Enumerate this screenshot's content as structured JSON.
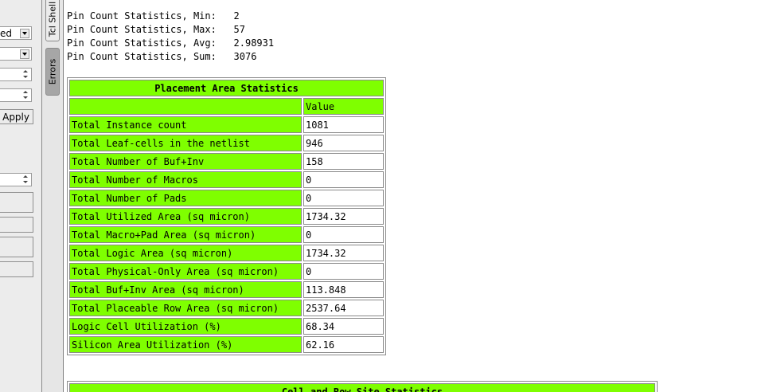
{
  "left_panel": {
    "combo1_text": "ed",
    "combo2_text": "",
    "spin1_value": "",
    "spin2_value": "",
    "apply_label": "Apply",
    "spin3_value": ""
  },
  "tabs": {
    "tcl_shell": "Tcl Shell",
    "errors": "Errors"
  },
  "pin_stats": [
    "Pin Count Statistics, Min:   2",
    "Pin Count Statistics, Max:   57",
    "Pin Count Statistics, Avg:   2.98931",
    "Pin Count Statistics, Sum:   3076"
  ],
  "placement_table": {
    "title": "Placement Area Statistics",
    "value_header": "Value",
    "rows": [
      {
        "label": "Total Instance count",
        "value": "1081"
      },
      {
        "label": "Total Leaf-cells in the netlist",
        "value": "946"
      },
      {
        "label": "Total Number of Buf+Inv",
        "value": "158"
      },
      {
        "label": "Total Number of Macros",
        "value": "0"
      },
      {
        "label": "Total Number of Pads",
        "value": "0"
      },
      {
        "label": "Total Utilized Area (sq micron)",
        "value": "1734.32"
      },
      {
        "label": "Total Macro+Pad Area (sq micron)",
        "value": "0"
      },
      {
        "label": "Total Logic Area (sq micron)",
        "value": "1734.32"
      },
      {
        "label": "Total Physical-Only Area (sq micron)",
        "value": "0"
      },
      {
        "label": "Total Buf+Inv Area (sq micron)",
        "value": "113.848"
      },
      {
        "label": "Total Placeable Row Area (sq micron)",
        "value": "2537.64"
      },
      {
        "label": "Logic Cell Utilization (%)",
        "value": "68.34"
      },
      {
        "label": "Silicon Area Utilization (%)",
        "value": "62.16"
      }
    ]
  },
  "cell_row_table": {
    "title": "Cell and Row Site Statistics"
  },
  "colors": {
    "table_green": "#7fff00",
    "panel_gray": "#ececec",
    "tab_active": "#a6a6a6"
  }
}
